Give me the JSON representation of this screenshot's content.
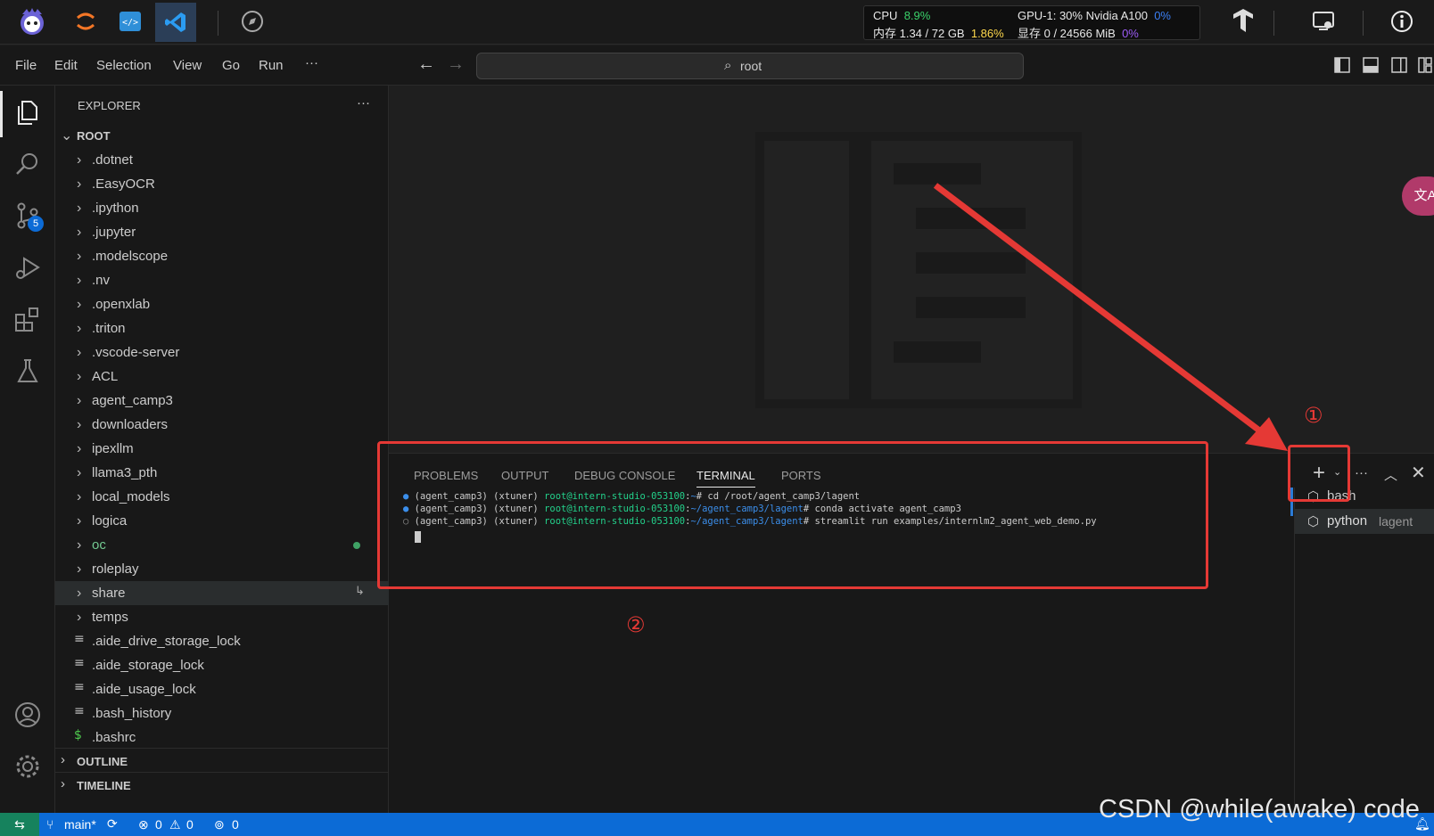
{
  "topbar": {
    "cpu_label": "CPU",
    "cpu_value": "8.9%",
    "mem_label": "内存 1.34 / 72 GB",
    "mem_value": "1.86%",
    "gpu_label": "GPU-1: 30% Nvidia A100",
    "gpu_value": "0%",
    "vram_label": "显存 0 / 24566 MiB",
    "vram_value": "0%"
  },
  "menubar": {
    "items": [
      "File",
      "Edit",
      "Selection",
      "View",
      "Go",
      "Run",
      "···"
    ],
    "search_text": "root"
  },
  "activity": {
    "scm_badge": "5"
  },
  "explorer": {
    "title": "EXPLORER",
    "more": "···",
    "root": "ROOT",
    "folders": [
      ".dotnet",
      ".EasyOCR",
      ".ipython",
      ".jupyter",
      ".modelscope",
      ".nv",
      ".openxlab",
      ".triton",
      ".vscode-server",
      "ACL",
      "agent_camp3",
      "downloaders",
      "ipexllm",
      "llama3_pth",
      "local_models",
      "logica",
      "oc",
      "roleplay",
      "share",
      "temps"
    ],
    "files": [
      ".aide_drive_storage_lock",
      ".aide_storage_lock",
      ".aide_usage_lock",
      ".bash_history",
      ".bashrc"
    ],
    "outline": "OUTLINE",
    "timeline": "TIMELINE"
  },
  "panel": {
    "tabs": [
      "PROBLEMS",
      "OUTPUT",
      "DEBUG CONSOLE",
      "TERMINAL",
      "PORTS"
    ],
    "active_tab": "TERMINAL",
    "terminal_lines": [
      {
        "env": "(agent_camp3) (xtuner)",
        "host": "root@intern-studio-053100",
        "path": "~",
        "cmd": "cd /root/agent_camp3/lagent"
      },
      {
        "env": "(agent_camp3) (xtuner)",
        "host": "root@intern-studio-053100",
        "path": "~/agent_camp3/lagent",
        "cmd": "conda activate agent_camp3"
      },
      {
        "env": "(agent_camp3) (xtuner)",
        "host": "root@intern-studio-053100",
        "path": "~/agent_camp3/lagent",
        "cmd": "streamlit run examples/internlm2_agent_web_demo.py"
      }
    ],
    "terminals": [
      {
        "name": "bash",
        "detail": ""
      },
      {
        "name": "python",
        "detail": "lagent"
      }
    ]
  },
  "annotations": {
    "marker1": "①",
    "marker2": "②"
  },
  "statusbar": {
    "branch": "main*",
    "errors": "0",
    "warnings": "0",
    "ports": "0"
  },
  "watermark": "CSDN @while(awake) code",
  "colors": {
    "accent": "#0c6bd6",
    "annotation_red": "#e53935",
    "terminal_green": "#23d18b",
    "terminal_blue": "#3b8eea"
  }
}
